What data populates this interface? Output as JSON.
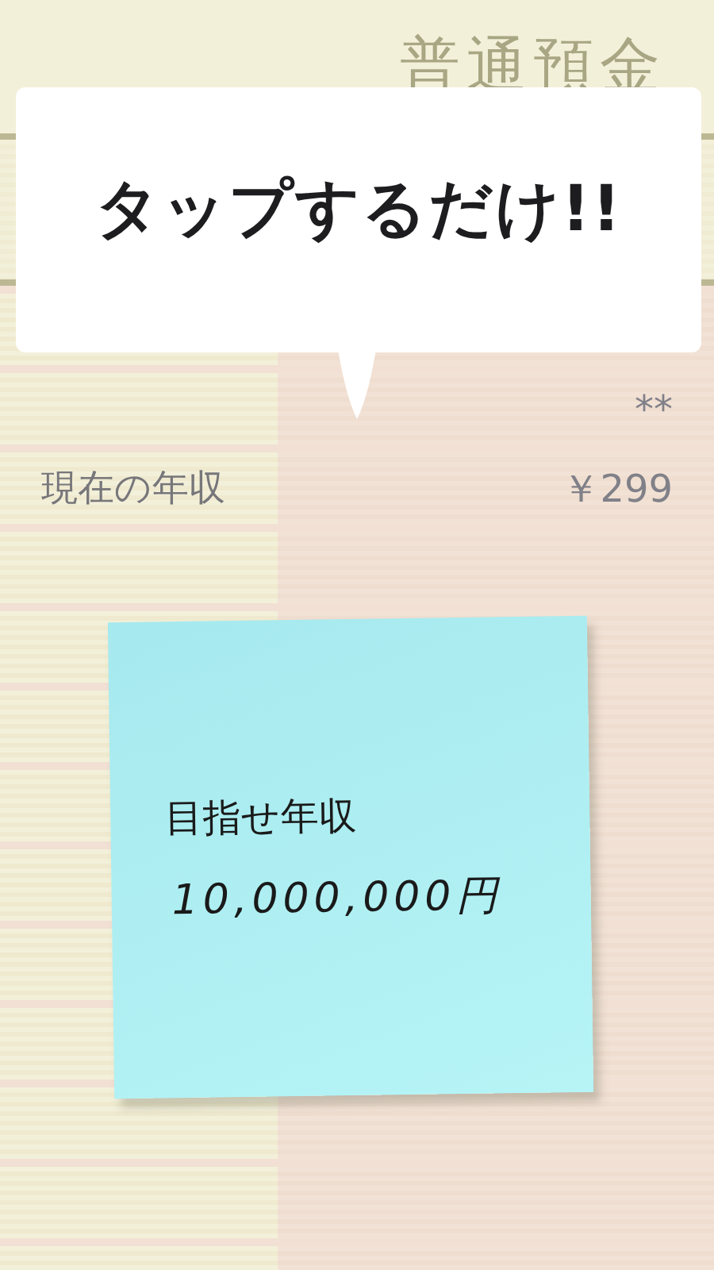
{
  "header": {
    "title": "普通預金"
  },
  "rows": [
    {
      "label": "",
      "value": ""
    },
    {
      "label": "",
      "value": "**"
    },
    {
      "label": "現在の年収",
      "value": "￥299"
    },
    {
      "label": "",
      "value": ""
    },
    {
      "label": "",
      "value": ""
    },
    {
      "label": "",
      "value": ""
    },
    {
      "label": "",
      "value": ""
    },
    {
      "label": "",
      "value": ""
    },
    {
      "label": "",
      "value": ""
    },
    {
      "label": "",
      "value": ""
    },
    {
      "label": "",
      "value": ""
    },
    {
      "label": "",
      "value": ""
    },
    {
      "label": "",
      "value": ""
    }
  ],
  "callout": {
    "text": "タップするだけ!!"
  },
  "sticky_note": {
    "heading": "目指せ年収",
    "amount": "10,000,000円"
  }
}
